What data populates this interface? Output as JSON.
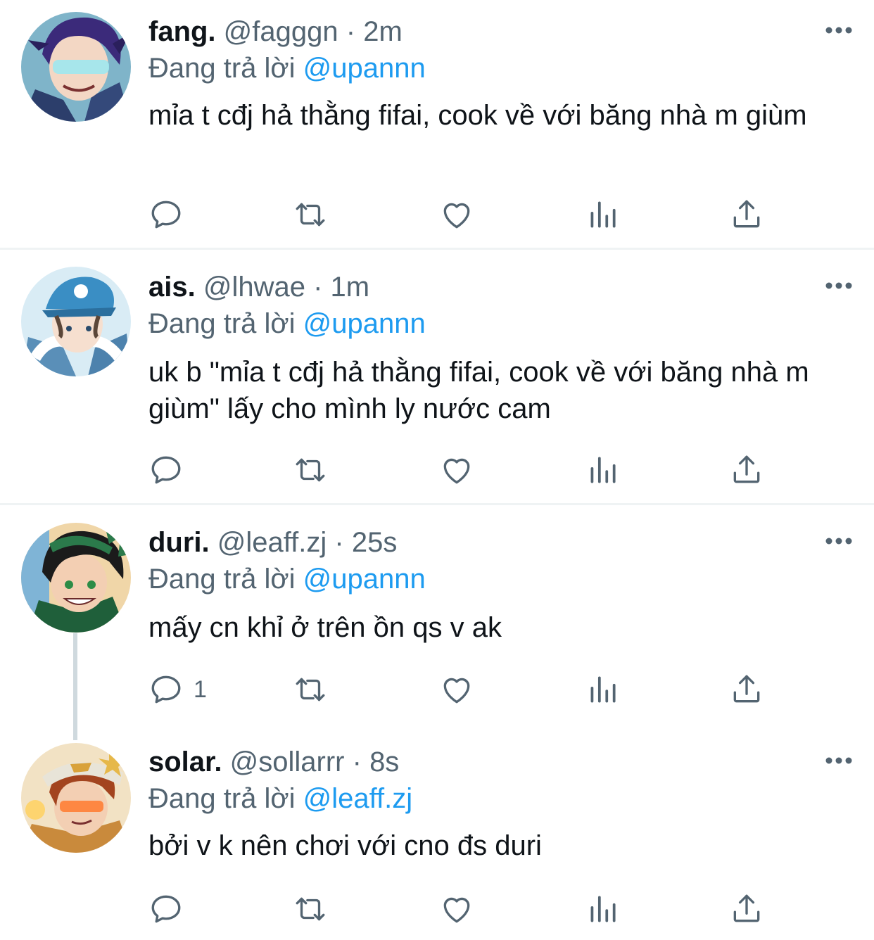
{
  "tweets": [
    {
      "name": "fang.",
      "handle": "@fagggn",
      "dot": "·",
      "time": "2m",
      "reply_prefix": "Đang trả lời",
      "reply_to": "@upannn",
      "text": "mỉa t cđj hả thằng fifai, cook về với băng nhà m giùm",
      "reply_count": "",
      "avatar_icon": "avatar-fang"
    },
    {
      "name": "ais.",
      "handle": "@lhwae",
      "dot": "·",
      "time": "1m",
      "reply_prefix": "Đang trả lời",
      "reply_to": "@upannn",
      "text": "uk b \"mỉa t cđj hả thằng fifai, cook về với băng nhà m giùm\" lấy cho mình ly nước cam",
      "reply_count": "",
      "avatar_icon": "avatar-ais"
    },
    {
      "name": "duri.",
      "handle": "@leaff.zj",
      "dot": "·",
      "time": "25s",
      "reply_prefix": "Đang trả lời",
      "reply_to": "@upannn",
      "text": "mấy cn khỉ ở trên ồn qs v ak",
      "reply_count": "1",
      "avatar_icon": "avatar-duri"
    },
    {
      "name": "solar.",
      "handle": "@sollarrr",
      "dot": "·",
      "time": "8s",
      "reply_prefix": "Đang trả lời",
      "reply_to": "@leaff.zj",
      "text": "bởi v k nên chơi với cno đs duri",
      "reply_count": "",
      "avatar_icon": "avatar-solar"
    }
  ],
  "icons": {
    "reply": "reply-icon",
    "retweet": "retweet-icon",
    "like": "heart-icon",
    "views": "views-icon",
    "share": "share-icon",
    "more": "more-icon"
  },
  "colors": {
    "text": "#0f1419",
    "secondary": "#536471",
    "mention": "#1d9bf0",
    "divider": "#eff3f4",
    "thread_line": "#cfd9de"
  }
}
